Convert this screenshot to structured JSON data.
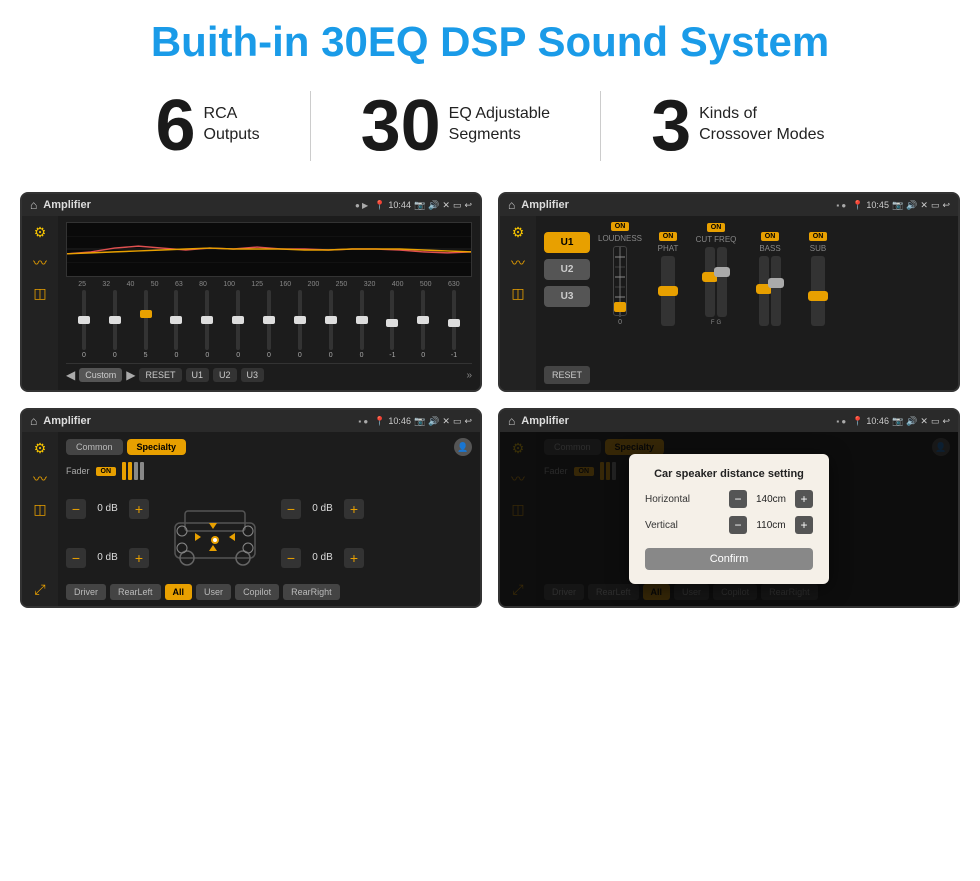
{
  "header": {
    "title": "Buith-in 30EQ DSP Sound System"
  },
  "stats": [
    {
      "number": "6",
      "label_line1": "RCA",
      "label_line2": "Outputs"
    },
    {
      "number": "30",
      "label_line1": "EQ Adjustable",
      "label_line2": "Segments"
    },
    {
      "number": "3",
      "label_line1": "Kinds of",
      "label_line2": "Crossover Modes"
    }
  ],
  "screens": [
    {
      "id": "eq-screen",
      "status_bar": {
        "app_name": "Amplifier",
        "time": "10:44"
      },
      "eq_freqs": [
        "25",
        "32",
        "40",
        "50",
        "63",
        "80",
        "100",
        "125",
        "160",
        "200",
        "250",
        "320",
        "400",
        "500",
        "630"
      ],
      "eq_values": [
        "0",
        "0",
        "0",
        "5",
        "0",
        "0",
        "0",
        "0",
        "0",
        "0",
        "0",
        "-1",
        "0",
        "-1"
      ],
      "bottom_buttons": [
        "Custom",
        "RESET",
        "U1",
        "U2",
        "U3"
      ]
    },
    {
      "id": "crossover-screen",
      "status_bar": {
        "app_name": "Amplifier",
        "time": "10:45"
      },
      "presets": [
        "U1",
        "U2",
        "U3"
      ],
      "channels": [
        {
          "label": "LOUDNESS",
          "on": true
        },
        {
          "label": "PHAT",
          "on": true
        },
        {
          "label": "CUT FREQ",
          "on": true
        },
        {
          "label": "BASS",
          "on": true
        },
        {
          "label": "SUB",
          "on": true
        }
      ]
    },
    {
      "id": "speaker-screen",
      "status_bar": {
        "app_name": "Amplifier",
        "time": "10:46"
      },
      "tabs": [
        "Common",
        "Specialty"
      ],
      "fader_label": "Fader",
      "fader_on": true,
      "db_values": [
        "0 dB",
        "0 dB",
        "0 dB",
        "0 dB"
      ],
      "footer_buttons": [
        "Driver",
        "RearLeft",
        "All",
        "User",
        "Copilot",
        "RearRight"
      ]
    },
    {
      "id": "dialog-screen",
      "status_bar": {
        "app_name": "Amplifier",
        "time": "10:46"
      },
      "tabs": [
        "Common",
        "Specialty"
      ],
      "dialog": {
        "title": "Car speaker distance setting",
        "horizontal_label": "Horizontal",
        "horizontal_value": "140cm",
        "vertical_label": "Vertical",
        "vertical_value": "110cm",
        "confirm_label": "Confirm"
      },
      "footer_buttons": [
        "Driver",
        "RearLeft",
        "All",
        "User",
        "Copilot",
        "RearRight"
      ]
    }
  ]
}
